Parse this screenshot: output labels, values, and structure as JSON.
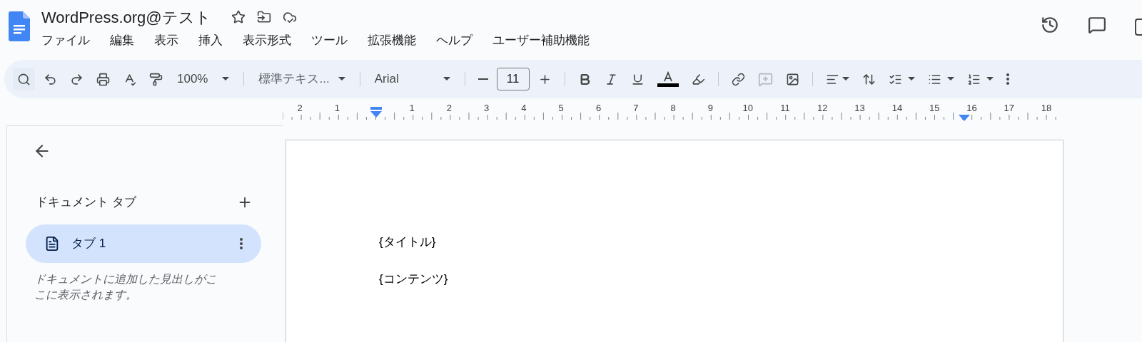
{
  "document_title": "WordPress.org@テスト",
  "menu": [
    "ファイル",
    "編集",
    "表示",
    "挿入",
    "表示形式",
    "ツール",
    "拡張機能",
    "ヘルプ",
    "ユーザー補助機能"
  ],
  "toolbar": {
    "zoom": "100%",
    "style": "標準テキス...",
    "font": "Arial",
    "font_size": "11",
    "add_comment": {
      "disabled": true
    }
  },
  "ruler": [
    "2",
    "1",
    "1",
    "2",
    "3",
    "4",
    "5",
    "6",
    "7",
    "8",
    "9",
    "10",
    "11",
    "12",
    "13",
    "14",
    "15",
    "16",
    "17",
    "18"
  ],
  "sidebar": {
    "heading": "ドキュメント タブ",
    "tabs": [
      {
        "label": "タブ 1",
        "selected": true
      }
    ],
    "hint": "ドキュメントに追加した見出しがここに表示されます。"
  },
  "page": {
    "paragraphs": [
      "{タイトル}",
      "{コンテンツ}"
    ]
  }
}
